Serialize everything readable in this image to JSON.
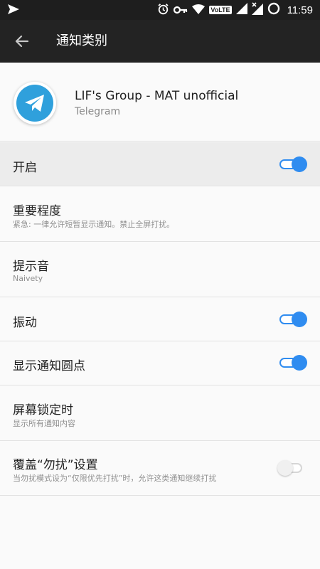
{
  "status_bar": {
    "time": "11:59",
    "volte": "VoLTE",
    "icons": [
      "send-arrow-icon",
      "alarm-icon",
      "key-icon",
      "wifi-icon",
      "volte-icon",
      "signal-icon",
      "signal-no-data-icon",
      "battery-circle-icon"
    ]
  },
  "app_bar": {
    "title": "通知类别"
  },
  "app_header": {
    "name": "LIF's Group - MAT unofficial",
    "app": "Telegram"
  },
  "settings": {
    "enable": {
      "label": "开启",
      "on": true
    },
    "importance": {
      "label": "重要程度",
      "sub": "紧急: 一律允许短暂显示通知。禁止全屏打扰。"
    },
    "sound": {
      "label": "提示音",
      "sub": "Naivety"
    },
    "vibrate": {
      "label": "振动",
      "on": true
    },
    "badge": {
      "label": "显示通知圆点",
      "on": true
    },
    "lockscreen": {
      "label": "屏幕锁定时",
      "sub": "显示所有通知内容"
    },
    "dnd": {
      "label": "覆盖“勿扰”设置",
      "sub": "当勿扰模式设为“仅限优先打扰”时，允许这类通知继续打扰",
      "on": false
    }
  },
  "colors": {
    "accent": "#2f8cf0",
    "app_bar": "#232323",
    "telegram_blue": "#2fa0dc"
  }
}
